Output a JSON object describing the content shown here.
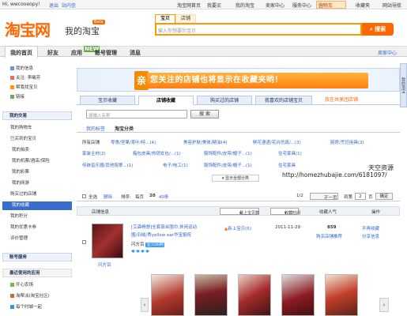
{
  "topbar": {
    "greeting": "Hi, wwcooeopy!",
    "logout": "退出",
    "inbox": "站内信",
    "links": [
      "淘宝网首页",
      "我要买",
      "我的淘宝",
      "卖家中心",
      "服务中心",
      "购物车",
      "收藏夹",
      "网站导航"
    ],
    "accent": "#ff6600"
  },
  "header": {
    "logo": "淘宝网",
    "subtitle": "我的淘宝",
    "beta": "Beta",
    "search_tabs": [
      "宝贝",
      "店铺"
    ],
    "search_placeholder": "输入你想要的宝贝",
    "search_button": "搜索"
  },
  "nav": {
    "items": [
      "我的首页",
      "好友",
      "应用",
      "账号管理",
      "消息"
    ],
    "app_badge": "NEW",
    "right_link": "卖家中心"
  },
  "sidebar": {
    "profile": [
      {
        "label": "我的信息",
        "icon": "user-icon"
      },
      {
        "label": "关注: 李曦芳",
        "icon": "heart-icon"
      },
      {
        "label": "帮我找宝贝",
        "icon": "search-icon"
      },
      {
        "label": "链接",
        "icon": "link-icon"
      }
    ],
    "section_trade": "我的交易",
    "trade_items": [
      "我的购物车",
      "已买到的宝贝",
      "我的拍卖",
      "我的机票/酒店/保险",
      "我的彩票",
      "我的网游",
      "购买过的店铺",
      "我的收藏",
      "我的积分",
      "我的优惠卡券",
      "评价管理"
    ],
    "active_index": 7,
    "section_safe": "账号服务",
    "section_apps": "最近使用的应用",
    "apps": [
      "开心农场",
      "淘帮派(淘宝社区)",
      "每个时城一起"
    ]
  },
  "banner": {
    "chip": "亲",
    "text": "您关注的店铺也将显示在收藏夹哟！"
  },
  "fav_tabs": [
    "宝贝收藏",
    "店铺收藏",
    "购买过的店铺",
    "我喜欢的店铺宝贝",
    "我在共享团店铺"
  ],
  "fav_tab_active": 1,
  "search2": {
    "placeholder": "请输入名称",
    "button": "搜 索"
  },
  "subtabs": [
    "我的标签",
    "淘宝分类"
  ],
  "categories": {
    "row1": [
      "所有店铺",
      "零食/坚果/茶叶/特...",
      "美容护肤/美体/精油",
      "鲜花速递/花卉仿真/...",
      "厨房/烹饪用具"
    ],
    "row1_counts": [
      "(4)",
      "(4)",
      "(3)",
      "(2)"
    ],
    "row2": [
      "家装主材",
      "箱包皮具/热销女包/...",
      "服饰配件/皮带/帽子...",
      "住宅家具"
    ],
    "row2_counts": [
      "(2)",
      "(1)",
      "(1)",
      "(1)"
    ],
    "row3": [
      "传统音乐器/其他按摩...",
      "电子/电工",
      "服饰配件/皮带/帽子...",
      "住宅家具"
    ],
    "row3_counts": [
      "(1)",
      "(1)",
      "(1)"
    ],
    "show_all": "显示全部分类"
  },
  "toolbar": {
    "select_all": "全选",
    "delete": "删除",
    "sort": "排序:",
    "per_page_label": "每页",
    "per_page": "20",
    "per_page_alt": "40条",
    "page_info": "1/2",
    "next": "下一页",
    "goto_prefix": "到第",
    "page_input": "2",
    "goto_suffix": "页",
    "confirm": "确定"
  },
  "table": {
    "headers": [
      "店铺信息",
      "最上宝贝数",
      "收藏时间",
      "收藏人气",
      "操作"
    ],
    "rows": [
      {
        "shop_title": "[艾森畅想]全套真丝围巾,休闲运动",
        "shop_title2": "围/羽绒/秀yellow ear华宝祖祝",
        "shop_owner": "闪方百",
        "shop_tag": "宝贝回购",
        "new_items": "新上宝贝(5)",
        "date": "2011-11-29",
        "popularity": "859",
        "popularity_sub": "购买店铺推荐",
        "op1": "不再收藏",
        "op2": "分享信息"
      }
    ]
  },
  "watermark": {
    "line1": "天空资源",
    "line2": "http://homezhubajie.com/6181097/"
  },
  "rightbar": "我的淘宝"
}
